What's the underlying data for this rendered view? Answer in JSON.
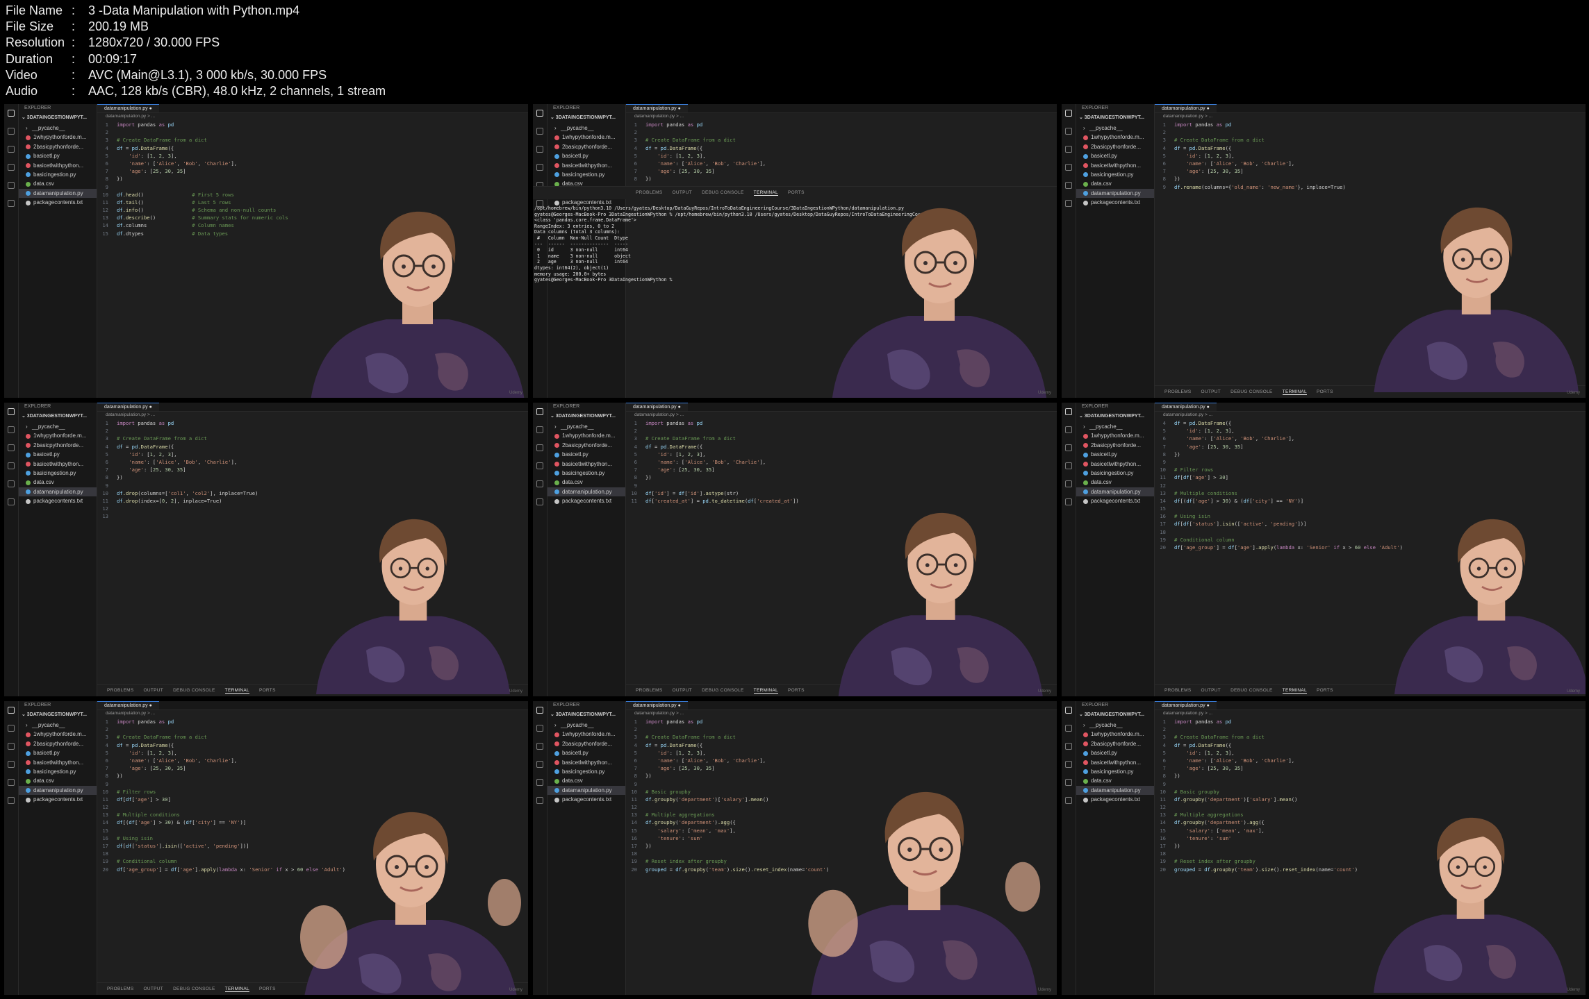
{
  "meta": [
    {
      "key": "File Name",
      "value": "3 -Data Manipulation with Python.mp4"
    },
    {
      "key": "File Size",
      "value": "200.19 MB"
    },
    {
      "key": "Resolution",
      "value": "1280x720 / 30.000 FPS"
    },
    {
      "key": "Duration",
      "value": "00:09:17"
    },
    {
      "key": "Video",
      "value": "AVC (Main@L3.1), 3 000 kb/s, 30.000 FPS"
    },
    {
      "key": "Audio",
      "value": "AAC, 128 kb/s (CBR), 48.0 kHz, 2 channels, 1 stream"
    }
  ],
  "explorer": {
    "header": "EXPLORER",
    "project": "3DATAINGESTIONWPYT...",
    "files": [
      "__pycache__",
      "1whypythonforde.m...",
      "2basicpythonforde...",
      "basicetl.py",
      "basicetlwithpython...",
      "basicingestion.py",
      "data.csv",
      "datamanipulation.py",
      "packagecontents.txt"
    ],
    "file_colors": [
      "#c5c5c5",
      "#e05561",
      "#e05561",
      "#4ea0e0",
      "#e05561",
      "#4ea0e0",
      "#6ab04c",
      "#4ea0e0",
      "#c5c5c5"
    ]
  },
  "editor": {
    "tab": "datamanipulation.py ●",
    "breadcrumb": "datamanipulation.py > ..."
  },
  "panel_tabs": [
    "PROBLEMS",
    "OUTPUT",
    "DEBUG CONSOLE",
    "TERMINAL",
    "PORTS"
  ],
  "watermark": "Udemy",
  "snippets": {
    "s1": [
      {
        "n": "1",
        "t": "import pandas as pd"
      },
      {
        "n": "2",
        "t": ""
      },
      {
        "n": "3",
        "t": "# Create DataFrame from a dict"
      },
      {
        "n": "4",
        "t": "df = pd.DataFrame({"
      },
      {
        "n": "5",
        "t": "    'id': [1, 2, 3],"
      },
      {
        "n": "6",
        "t": "    'name': ['Alice', 'Bob', 'Charlie'],"
      },
      {
        "n": "7",
        "t": "    'age': [25, 30, 35]"
      },
      {
        "n": "8",
        "t": "})"
      },
      {
        "n": "9",
        "t": ""
      },
      {
        "n": "10",
        "t": "df.head()                # First 5 rows"
      },
      {
        "n": "11",
        "t": "df.tail()                # Last 5 rows"
      },
      {
        "n": "12",
        "t": "df.info()                # Schema and non-null counts"
      },
      {
        "n": "13",
        "t": "df.describe()            # Summary stats for numeric cols"
      },
      {
        "n": "14",
        "t": "df.columns               # Column names"
      },
      {
        "n": "15",
        "t": "df.dtypes                # Data types"
      }
    ],
    "s2": [
      {
        "n": "1",
        "t": "import pandas as pd"
      },
      {
        "n": "2",
        "t": ""
      },
      {
        "n": "3",
        "t": "# Create DataFrame from a dict"
      },
      {
        "n": "4",
        "t": "df = pd.DataFrame({"
      },
      {
        "n": "5",
        "t": "    'id': [1, 2, 3],"
      },
      {
        "n": "6",
        "t": "    'name': ['Alice', 'Bob', 'Charlie'],"
      },
      {
        "n": "7",
        "t": "    'age': [25, 30, 35]"
      },
      {
        "n": "8",
        "t": "})"
      }
    ],
    "s3": [
      {
        "n": "1",
        "t": "import pandas as pd"
      },
      {
        "n": "2",
        "t": ""
      },
      {
        "n": "3",
        "t": "# Create DataFrame from a dict"
      },
      {
        "n": "4",
        "t": "df = pd.DataFrame({"
      },
      {
        "n": "5",
        "t": "    'id': [1, 2, 3],"
      },
      {
        "n": "6",
        "t": "    'name': ['Alice', 'Bob', 'Charlie'],"
      },
      {
        "n": "7",
        "t": "    'age': [25, 30, 35]"
      },
      {
        "n": "8",
        "t": "})"
      },
      {
        "n": "9",
        "t": "df.rename(columns={'old_name': 'new_name'}, inplace=True)"
      }
    ],
    "s4": [
      {
        "n": "1",
        "t": "import pandas as pd"
      },
      {
        "n": "2",
        "t": ""
      },
      {
        "n": "3",
        "t": "# Create DataFrame from a dict"
      },
      {
        "n": "4",
        "t": "df = pd.DataFrame({"
      },
      {
        "n": "5",
        "t": "    'id': [1, 2, 3],"
      },
      {
        "n": "6",
        "t": "    'name': ['Alice', 'Bob', 'Charlie'],"
      },
      {
        "n": "7",
        "t": "    'age': [25, 30, 35]"
      },
      {
        "n": "8",
        "t": "})"
      },
      {
        "n": "9",
        "t": ""
      },
      {
        "n": "10",
        "t": "df.drop(columns=['col1', 'col2'], inplace=True)"
      },
      {
        "n": "11",
        "t": "df.drop(index=[0, 2], inplace=True)"
      },
      {
        "n": "12",
        "t": ""
      },
      {
        "n": "13",
        "t": ""
      }
    ],
    "s5": [
      {
        "n": "1",
        "t": "import pandas as pd"
      },
      {
        "n": "2",
        "t": ""
      },
      {
        "n": "3",
        "t": "# Create DataFrame from a dict"
      },
      {
        "n": "4",
        "t": "df = pd.DataFrame({"
      },
      {
        "n": "5",
        "t": "    'id': [1, 2, 3],"
      },
      {
        "n": "6",
        "t": "    'name': ['Alice', 'Bob', 'Charlie'],"
      },
      {
        "n": "7",
        "t": "    'age': [25, 30, 35]"
      },
      {
        "n": "8",
        "t": "})"
      },
      {
        "n": "9",
        "t": ""
      },
      {
        "n": "10",
        "t": "df['id'] = df['id'].astype(str)"
      },
      {
        "n": "11",
        "t": "df['created_at'] = pd.to_datetime(df['created_at'])"
      }
    ],
    "s6": [
      {
        "n": "4",
        "t": "df = pd.DataFrame({"
      },
      {
        "n": "5",
        "t": "    'id': [1, 2, 3],"
      },
      {
        "n": "6",
        "t": "    'name': ['Alice', 'Bob', 'Charlie'],"
      },
      {
        "n": "7",
        "t": "    'age': [25, 30, 35]"
      },
      {
        "n": "8",
        "t": "})"
      },
      {
        "n": "9",
        "t": ""
      },
      {
        "n": "10",
        "t": "# Filter rows"
      },
      {
        "n": "11",
        "t": "df[df['age'] > 30]"
      },
      {
        "n": "12",
        "t": ""
      },
      {
        "n": "13",
        "t": "# Multiple conditions"
      },
      {
        "n": "14",
        "t": "df[(df['age'] > 30) & (df['city'] == 'NY')]"
      },
      {
        "n": "15",
        "t": ""
      },
      {
        "n": "16",
        "t": "# Using isin"
      },
      {
        "n": "17",
        "t": "df[df['status'].isin(['active', 'pending'])]"
      },
      {
        "n": "18",
        "t": ""
      },
      {
        "n": "19",
        "t": "# Conditional column"
      },
      {
        "n": "20",
        "t": "df['age_group'] = df['age'].apply(lambda x: 'Senior' if x > 60 else 'Adult')"
      }
    ],
    "s7": [
      {
        "n": "1",
        "t": "import pandas as pd"
      },
      {
        "n": "2",
        "t": ""
      },
      {
        "n": "3",
        "t": "# Create DataFrame from a dict"
      },
      {
        "n": "4",
        "t": "df = pd.DataFrame({"
      },
      {
        "n": "5",
        "t": "    'id': [1, 2, 3],"
      },
      {
        "n": "6",
        "t": "    'name': ['Alice', 'Bob', 'Charlie'],"
      },
      {
        "n": "7",
        "t": "    'age': [25, 30, 35]"
      },
      {
        "n": "8",
        "t": "})"
      },
      {
        "n": "9",
        "t": ""
      },
      {
        "n": "10",
        "t": "# Filter rows"
      },
      {
        "n": "11",
        "t": "df[df['age'] > 30]"
      },
      {
        "n": "12",
        "t": ""
      },
      {
        "n": "13",
        "t": "# Multiple conditions"
      },
      {
        "n": "14",
        "t": "df[(df['age'] > 30) & (df['city'] == 'NY')]"
      },
      {
        "n": "15",
        "t": ""
      },
      {
        "n": "16",
        "t": "# Using isin"
      },
      {
        "n": "17",
        "t": "df[df['status'].isin(['active', 'pending'])]"
      },
      {
        "n": "18",
        "t": ""
      },
      {
        "n": "19",
        "t": "# Conditional column"
      },
      {
        "n": "20",
        "t": "df['age_group'] = df['age'].apply(lambda x: 'Senior' if x > 60 else 'Adult')"
      }
    ],
    "s8": [
      {
        "n": "1",
        "t": "import pandas as pd"
      },
      {
        "n": "2",
        "t": ""
      },
      {
        "n": "3",
        "t": "# Create DataFrame from a dict"
      },
      {
        "n": "4",
        "t": "df = pd.DataFrame({"
      },
      {
        "n": "5",
        "t": "    'id': [1, 2, 3],"
      },
      {
        "n": "6",
        "t": "    'name': ['Alice', 'Bob', 'Charlie'],"
      },
      {
        "n": "7",
        "t": "    'age': [25, 30, 35]"
      },
      {
        "n": "8",
        "t": "})"
      },
      {
        "n": "9",
        "t": ""
      },
      {
        "n": "10",
        "t": "# Basic groupby"
      },
      {
        "n": "11",
        "t": "df.groupby('department')['salary'].mean()"
      },
      {
        "n": "12",
        "t": ""
      },
      {
        "n": "13",
        "t": "# Multiple aggregations"
      },
      {
        "n": "14",
        "t": "df.groupby('department').agg({"
      },
      {
        "n": "15",
        "t": "    'salary': ['mean', 'max'],"
      },
      {
        "n": "16",
        "t": "    'tenure': 'sum'"
      },
      {
        "n": "17",
        "t": "})"
      },
      {
        "n": "18",
        "t": ""
      },
      {
        "n": "19",
        "t": "# Reset index after groupby"
      },
      {
        "n": "20",
        "t": "grouped = df.groupby('team').size().reset_index(name='count')"
      }
    ]
  },
  "terminal_lines": [
    "/opt/homebrew/bin/python3.10 /Users/gyates/Desktop/DataGuyRepos/IntroToDataEngineeringCourse/3DataIngestionWPython/datamanipulation.py",
    "gyates@Georges-MacBook-Pro 3DataIngestionWPython % /opt/homebrew/bin/python3.10 /Users/gyates/Desktop/DataGuyRepos/IntroToDataEngineeringCourse",
    "<class 'pandas.core.frame.DataFrame'>",
    "RangeIndex: 3 entries, 0 to 2",
    "Data columns (total 3 columns):",
    " #   Column  Non-Null Count  Dtype",
    "---  ------  --------------  -----",
    " 0   id      3 non-null      int64",
    " 1   name    3 non-null      object",
    " 2   age     3 non-null      int64",
    "dtypes: int64(2), object(1)",
    "memory usage: 200.0+ bytes",
    "gyates@Georges-MacBook-Pro 3DataIngestionWPython %"
  ]
}
